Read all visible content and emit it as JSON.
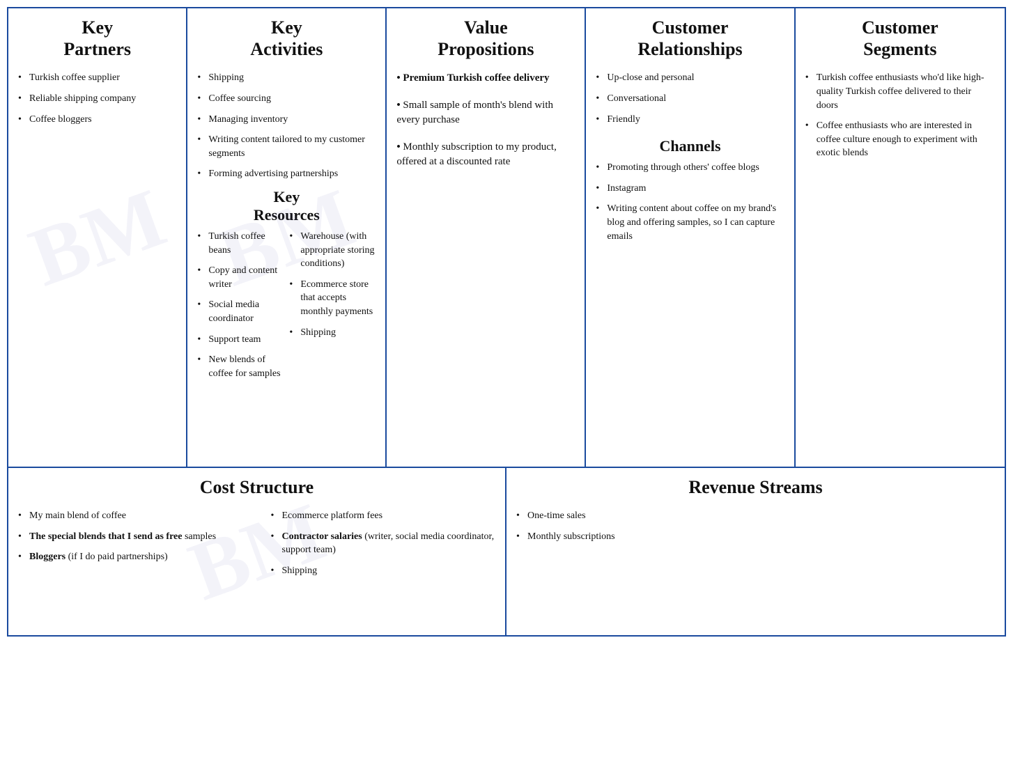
{
  "canvas": {
    "keyPartners": {
      "title": "Key\nPartners",
      "items": [
        "Turkish coffee supplier",
        "Reliable shipping company",
        "Coffee bloggers"
      ]
    },
    "keyActivities": {
      "title": "Key\nActivities",
      "items": [
        "Shipping",
        "Coffee sourcing",
        "Managing inventory",
        "Writing content tailored to my customer segments",
        "Forming advertising partnerships"
      ],
      "resourcesTitle": "Key\nResources",
      "resourcesLeft": [
        "Turkish coffee beans",
        "Copy and content writer",
        "Social media coordinator",
        "Support team",
        "New blends of coffee for samples"
      ],
      "resourcesRight": [
        "Warehouse (with appropriate storing conditions)",
        "Ecommerce store that accepts monthly payments",
        "Shipping"
      ]
    },
    "valuePropositions": {
      "title": "Value\nPropositions",
      "items": [
        "Premium Turkish coffee delivery",
        "Small sample of month's blend with every purchase",
        "Monthly subscription to my product, offered at a discounted rate"
      ]
    },
    "customerRelationships": {
      "title": "Customer\nRelationships",
      "items": [
        "Up-close and personal",
        "Conversational",
        "Friendly"
      ],
      "channelsTitle": "Channels",
      "channelsItems": [
        "Promoting through others' coffee blogs",
        "Instagram",
        "Writing content about coffee on my brand's blog and offering samples, so I can capture emails"
      ]
    },
    "customerSegments": {
      "title": "Customer\nSegments",
      "items": [
        "Turkish coffee enthusiasts who'd like high-quality Turkish coffee delivered to their doors",
        "Coffee enthusiasts who are interested in coffee culture enough to experiment with exotic blends"
      ]
    },
    "costStructure": {
      "title": "Cost Structure",
      "col1": [
        {
          "text": "My main blend of coffee",
          "bold": false
        },
        {
          "text": "The special blends that I send as free samples",
          "bold": true,
          "boldPart": "The special blends that I send as free",
          "normalPart": " samples"
        },
        {
          "text": "Bloggers (if I do paid partnerships)",
          "bold": true,
          "boldPart": "Bloggers",
          "normalPart": " (if I do paid partnerships)"
        }
      ],
      "col2": [
        {
          "text": "Ecommerce platform fees",
          "bold": false
        },
        {
          "text": "Contractor salaries (writer, social media coordinator, support team)",
          "bold": true,
          "boldPart": "Contractor salaries",
          "normalPart": " (writer, social media coordinator, support team)"
        },
        {
          "text": "Shipping",
          "bold": false
        }
      ]
    },
    "revenueStreams": {
      "title": "Revenue Streams",
      "items": [
        "One-time sales",
        "Monthly subscriptions"
      ]
    }
  }
}
